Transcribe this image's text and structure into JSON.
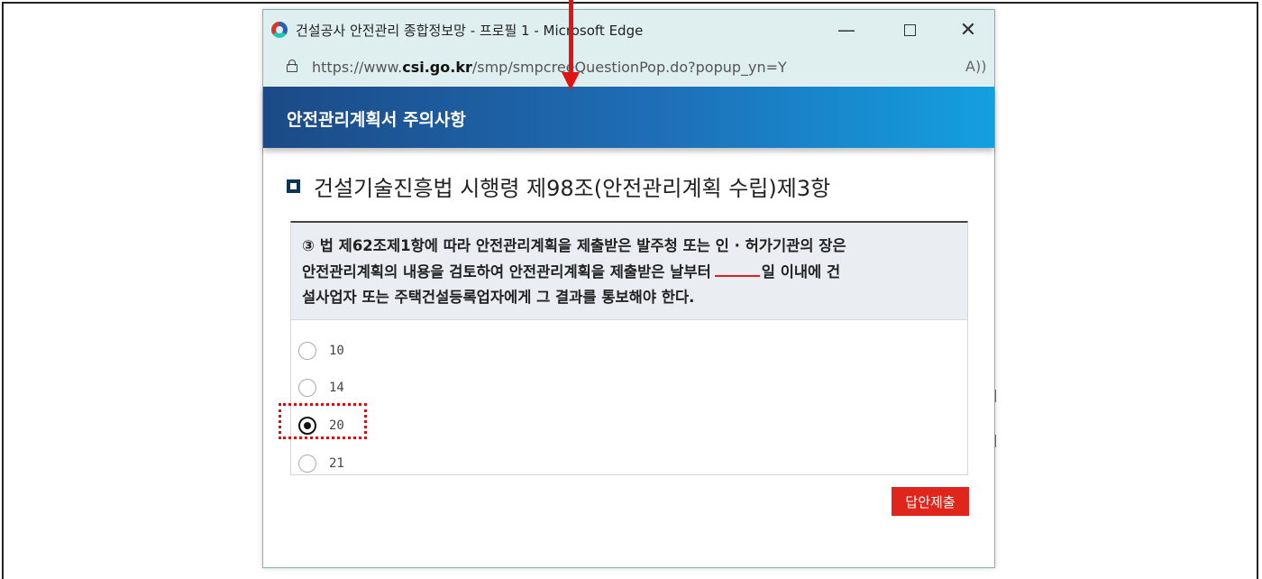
{
  "window": {
    "title": "건설공사 안전관리 종합정보망 - 프로필 1 - Microsoft Edge",
    "minimize_glyph": "—",
    "close_glyph": "✕"
  },
  "address": {
    "url_prefix": "https://www.",
    "url_domain": "csi.go.kr",
    "url_path": "/smp/smpcreeQuestionPop.do?popup_yn=Y",
    "read_aloud_glyph": "A))"
  },
  "header": {
    "title": "안전관리계획서 주의사항"
  },
  "section": {
    "title": "건설기술진흥법 시행령 제98조(안전관리계획 수립)제3항"
  },
  "question": {
    "line1": "③ 법 제62조제1항에 따라 안전관리계획을 제출받은 발주청 또는 인 · 허가기관의 장은",
    "line2_before": "안전관리계획의 내용을 검토하여 안전관리계획을 제출받은 날부터",
    "line2_after": "일 이내에 건",
    "line3": "설사업자 또는 주택건설등록업자에게 그 결과를 통보해야 한다."
  },
  "options": [
    {
      "label": "10",
      "selected": false
    },
    {
      "label": "14",
      "selected": false
    },
    {
      "label": "20",
      "selected": true
    },
    {
      "label": "21",
      "selected": false
    }
  ],
  "submit_label": "답안제출",
  "colors": {
    "accent_red": "#e0261c",
    "header_dark": "#1c4a86",
    "header_light": "#13a0e0",
    "titlebar": "#dfeeee"
  },
  "icons": [
    "edge-logo-icon",
    "lock-icon",
    "read-aloud-icon",
    "square-bullet-icon",
    "red-arrow-icon"
  ]
}
